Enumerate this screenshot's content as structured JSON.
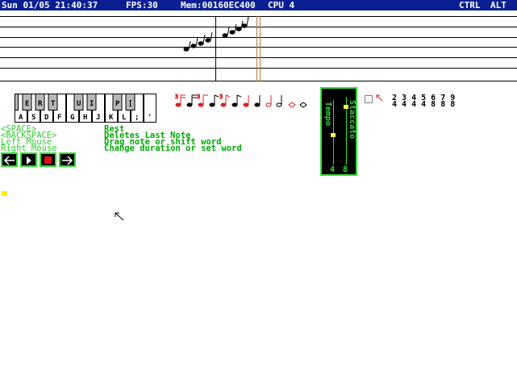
{
  "status_bar": {
    "datetime": "Sun 01/05 21:40:37",
    "fps": "FPS:30",
    "mem": "Mem:00160EC400",
    "cpu": "CPU 4",
    "ctrl": "CTRL",
    "alt": "ALT"
  },
  "piano": {
    "upper_keys": [
      "E",
      "R",
      "T",
      "U",
      "I",
      "P",
      "["
    ],
    "lower_keys": [
      "A",
      "S",
      "D",
      "F",
      "G",
      "H",
      "J",
      "K",
      "L",
      ";",
      "'"
    ]
  },
  "help": [
    {
      "key": "<SPACE>",
      "desc": "Rest"
    },
    {
      "key": "<BACKSPACE>",
      "desc": "Deletes Last Note"
    },
    {
      "key": "Left Mouse",
      "desc": "Drag note or shift word"
    },
    {
      "key": "Right Mouse",
      "desc": "Change duration or set word"
    }
  ],
  "sliders": {
    "tempo_label": "Tempo",
    "staccato_label": "Staccato",
    "tempo_value": "4",
    "staccato_value": "8"
  },
  "time_signatures": {
    "numerators": "2 3 4 5 6 7 9",
    "denominators": "4 4 4 4 8 8 8"
  },
  "icons": [
    "back-arrow-icon",
    "play-icon",
    "record-icon",
    "forward-arrow-icon",
    "select-box-icon",
    "pointer-icon"
  ],
  "colors": {
    "accent_green": "#33dd33",
    "title_bar": "#0b1f93",
    "note_red": "#dd2222",
    "cursor_yellow": "#ffee00"
  }
}
